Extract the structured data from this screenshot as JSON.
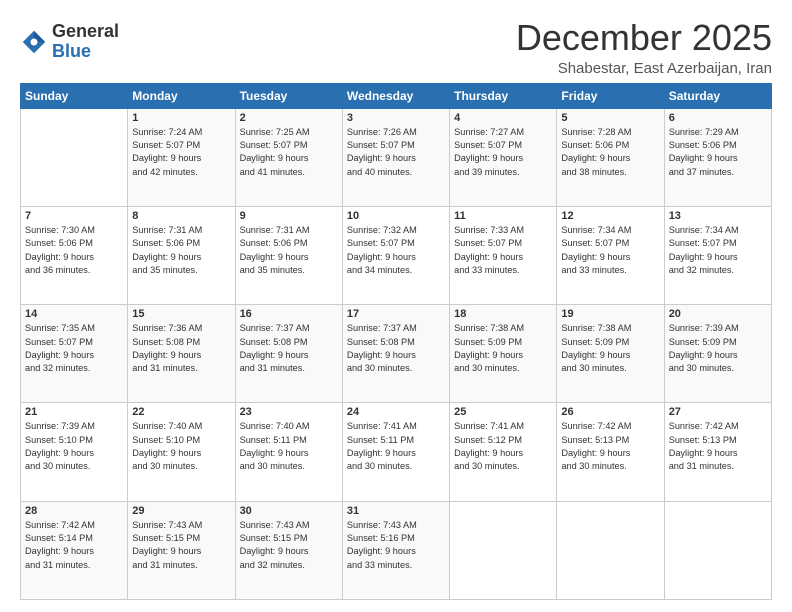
{
  "header": {
    "logo": {
      "general": "General",
      "blue": "Blue"
    },
    "title": "December 2025",
    "subtitle": "Shabestar, East Azerbaijan, Iran"
  },
  "columns": [
    "Sunday",
    "Monday",
    "Tuesday",
    "Wednesday",
    "Thursday",
    "Friday",
    "Saturday"
  ],
  "weeks": [
    {
      "rowBg": "light",
      "days": [
        {
          "date": "",
          "info": ""
        },
        {
          "date": "1",
          "info": "Sunrise: 7:24 AM\nSunset: 5:07 PM\nDaylight: 9 hours\nand 42 minutes."
        },
        {
          "date": "2",
          "info": "Sunrise: 7:25 AM\nSunset: 5:07 PM\nDaylight: 9 hours\nand 41 minutes."
        },
        {
          "date": "3",
          "info": "Sunrise: 7:26 AM\nSunset: 5:07 PM\nDaylight: 9 hours\nand 40 minutes."
        },
        {
          "date": "4",
          "info": "Sunrise: 7:27 AM\nSunset: 5:07 PM\nDaylight: 9 hours\nand 39 minutes."
        },
        {
          "date": "5",
          "info": "Sunrise: 7:28 AM\nSunset: 5:06 PM\nDaylight: 9 hours\nand 38 minutes."
        },
        {
          "date": "6",
          "info": "Sunrise: 7:29 AM\nSunset: 5:06 PM\nDaylight: 9 hours\nand 37 minutes."
        }
      ]
    },
    {
      "rowBg": "dark",
      "days": [
        {
          "date": "7",
          "info": "Sunrise: 7:30 AM\nSunset: 5:06 PM\nDaylight: 9 hours\nand 36 minutes."
        },
        {
          "date": "8",
          "info": "Sunrise: 7:31 AM\nSunset: 5:06 PM\nDaylight: 9 hours\nand 35 minutes."
        },
        {
          "date": "9",
          "info": "Sunrise: 7:31 AM\nSunset: 5:06 PM\nDaylight: 9 hours\nand 35 minutes."
        },
        {
          "date": "10",
          "info": "Sunrise: 7:32 AM\nSunset: 5:07 PM\nDaylight: 9 hours\nand 34 minutes."
        },
        {
          "date": "11",
          "info": "Sunrise: 7:33 AM\nSunset: 5:07 PM\nDaylight: 9 hours\nand 33 minutes."
        },
        {
          "date": "12",
          "info": "Sunrise: 7:34 AM\nSunset: 5:07 PM\nDaylight: 9 hours\nand 33 minutes."
        },
        {
          "date": "13",
          "info": "Sunrise: 7:34 AM\nSunset: 5:07 PM\nDaylight: 9 hours\nand 32 minutes."
        }
      ]
    },
    {
      "rowBg": "light",
      "days": [
        {
          "date": "14",
          "info": "Sunrise: 7:35 AM\nSunset: 5:07 PM\nDaylight: 9 hours\nand 32 minutes."
        },
        {
          "date": "15",
          "info": "Sunrise: 7:36 AM\nSunset: 5:08 PM\nDaylight: 9 hours\nand 31 minutes."
        },
        {
          "date": "16",
          "info": "Sunrise: 7:37 AM\nSunset: 5:08 PM\nDaylight: 9 hours\nand 31 minutes."
        },
        {
          "date": "17",
          "info": "Sunrise: 7:37 AM\nSunset: 5:08 PM\nDaylight: 9 hours\nand 30 minutes."
        },
        {
          "date": "18",
          "info": "Sunrise: 7:38 AM\nSunset: 5:09 PM\nDaylight: 9 hours\nand 30 minutes."
        },
        {
          "date": "19",
          "info": "Sunrise: 7:38 AM\nSunset: 5:09 PM\nDaylight: 9 hours\nand 30 minutes."
        },
        {
          "date": "20",
          "info": "Sunrise: 7:39 AM\nSunset: 5:09 PM\nDaylight: 9 hours\nand 30 minutes."
        }
      ]
    },
    {
      "rowBg": "dark",
      "days": [
        {
          "date": "21",
          "info": "Sunrise: 7:39 AM\nSunset: 5:10 PM\nDaylight: 9 hours\nand 30 minutes."
        },
        {
          "date": "22",
          "info": "Sunrise: 7:40 AM\nSunset: 5:10 PM\nDaylight: 9 hours\nand 30 minutes."
        },
        {
          "date": "23",
          "info": "Sunrise: 7:40 AM\nSunset: 5:11 PM\nDaylight: 9 hours\nand 30 minutes."
        },
        {
          "date": "24",
          "info": "Sunrise: 7:41 AM\nSunset: 5:11 PM\nDaylight: 9 hours\nand 30 minutes."
        },
        {
          "date": "25",
          "info": "Sunrise: 7:41 AM\nSunset: 5:12 PM\nDaylight: 9 hours\nand 30 minutes."
        },
        {
          "date": "26",
          "info": "Sunrise: 7:42 AM\nSunset: 5:13 PM\nDaylight: 9 hours\nand 30 minutes."
        },
        {
          "date": "27",
          "info": "Sunrise: 7:42 AM\nSunset: 5:13 PM\nDaylight: 9 hours\nand 31 minutes."
        }
      ]
    },
    {
      "rowBg": "light",
      "days": [
        {
          "date": "28",
          "info": "Sunrise: 7:42 AM\nSunset: 5:14 PM\nDaylight: 9 hours\nand 31 minutes."
        },
        {
          "date": "29",
          "info": "Sunrise: 7:43 AM\nSunset: 5:15 PM\nDaylight: 9 hours\nand 31 minutes."
        },
        {
          "date": "30",
          "info": "Sunrise: 7:43 AM\nSunset: 5:15 PM\nDaylight: 9 hours\nand 32 minutes."
        },
        {
          "date": "31",
          "info": "Sunrise: 7:43 AM\nSunset: 5:16 PM\nDaylight: 9 hours\nand 33 minutes."
        },
        {
          "date": "",
          "info": ""
        },
        {
          "date": "",
          "info": ""
        },
        {
          "date": "",
          "info": ""
        }
      ]
    }
  ]
}
